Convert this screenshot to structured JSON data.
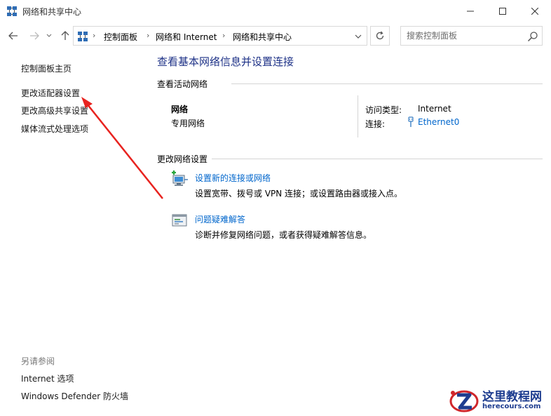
{
  "window": {
    "title": "网络和共享中心",
    "icon": "network-icon"
  },
  "navigation": {
    "breadcrumbs": [
      "控制面板",
      "网络和 Internet",
      "网络和共享中心"
    ],
    "search_placeholder": "搜索控制面板"
  },
  "sidebar": {
    "links": [
      "控制面板主页",
      "更改适配器设置",
      "更改高级共享设置",
      "媒体流式处理选项"
    ],
    "see_also_heading": "另请参阅",
    "see_also_links": [
      "Internet 选项",
      "Windows Defender 防火墙"
    ]
  },
  "main": {
    "title": "查看基本网络信息并设置连接",
    "active_networks_heading": "查看活动网络",
    "network": {
      "name": "网络",
      "type": "专用网络",
      "access_type_label": "访问类型:",
      "access_type_value": "Internet",
      "connection_label": "连接:",
      "connection_value": "Ethernet0"
    },
    "change_settings_heading": "更改网络设置",
    "tasks": [
      {
        "link": "设置新的连接或网络",
        "description": "设置宽带、拨号或 VPN 连接；或设置路由器或接入点。",
        "icon": "new-connection-icon"
      },
      {
        "link": "问题疑难解答",
        "description": "诊断并修复网络问题，或者获得疑难解答信息。",
        "icon": "troubleshoot-icon"
      }
    ]
  },
  "watermark": {
    "text_cn": "这里教程网",
    "text_en": "herecours.com"
  },
  "colors": {
    "title_blue": "#1e3287",
    "link_blue": "#0066cc",
    "arrow_red": "#e8231f"
  }
}
